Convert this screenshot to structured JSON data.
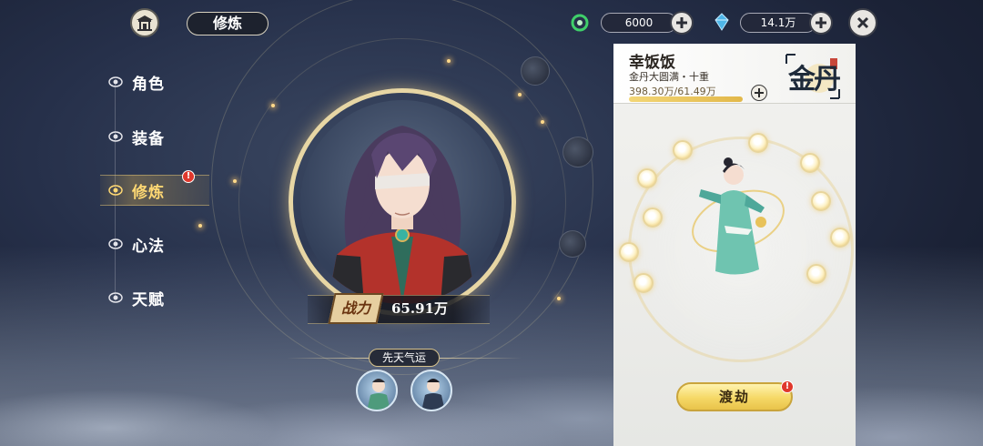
{
  "header": {
    "title": "修炼",
    "currency_jade": "6000",
    "currency_crystal": "14.1万"
  },
  "menu": {
    "items": [
      {
        "label": "角色"
      },
      {
        "label": "装备"
      },
      {
        "label": "修炼",
        "active": true,
        "badge": "!"
      },
      {
        "label": "心法"
      },
      {
        "label": "天赋"
      }
    ]
  },
  "character": {
    "power_seal": "战力",
    "power_value": "65.91万",
    "fate_label": "先天气运"
  },
  "panel": {
    "player_name": "幸饭饭",
    "realm": "金丹大圆满・十重",
    "exp_text": "398.30万/61.49万",
    "exp_progress": 1.0,
    "realm_seal": "金丹",
    "tribulation_button": "渡劫",
    "tribulation_badge": "!"
  },
  "colors": {
    "accent_gold": "#ffd873",
    "badge_red": "#e0382c",
    "button_yellow": "#f5d866"
  }
}
